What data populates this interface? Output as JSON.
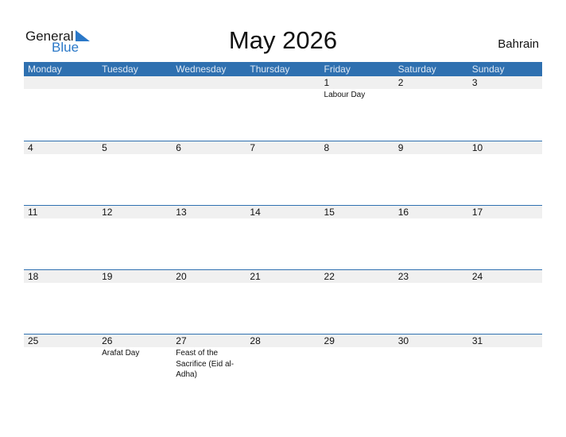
{
  "logo": {
    "general": "General",
    "blue": "Blue"
  },
  "title": "May 2026",
  "country": "Bahrain",
  "weekdays": [
    "Monday",
    "Tuesday",
    "Wednesday",
    "Thursday",
    "Friday",
    "Saturday",
    "Sunday"
  ],
  "weeks": [
    [
      {
        "d": ""
      },
      {
        "d": ""
      },
      {
        "d": ""
      },
      {
        "d": ""
      },
      {
        "d": "1",
        "e": "Labour Day"
      },
      {
        "d": "2"
      },
      {
        "d": "3"
      }
    ],
    [
      {
        "d": "4"
      },
      {
        "d": "5"
      },
      {
        "d": "6"
      },
      {
        "d": "7"
      },
      {
        "d": "8"
      },
      {
        "d": "9"
      },
      {
        "d": "10"
      }
    ],
    [
      {
        "d": "11"
      },
      {
        "d": "12"
      },
      {
        "d": "13"
      },
      {
        "d": "14"
      },
      {
        "d": "15"
      },
      {
        "d": "16"
      },
      {
        "d": "17"
      }
    ],
    [
      {
        "d": "18"
      },
      {
        "d": "19"
      },
      {
        "d": "20"
      },
      {
        "d": "21"
      },
      {
        "d": "22"
      },
      {
        "d": "23"
      },
      {
        "d": "24"
      }
    ],
    [
      {
        "d": "25"
      },
      {
        "d": "26",
        "e": "Arafat Day"
      },
      {
        "d": "27",
        "e": "Feast of the Sacrifice (Eid al-Adha)"
      },
      {
        "d": "28"
      },
      {
        "d": "29"
      },
      {
        "d": "30"
      },
      {
        "d": "31"
      }
    ]
  ],
  "colors": {
    "header": "#2f70b0",
    "brand_blue": "#2a78c8",
    "band": "#f0f0f0"
  }
}
